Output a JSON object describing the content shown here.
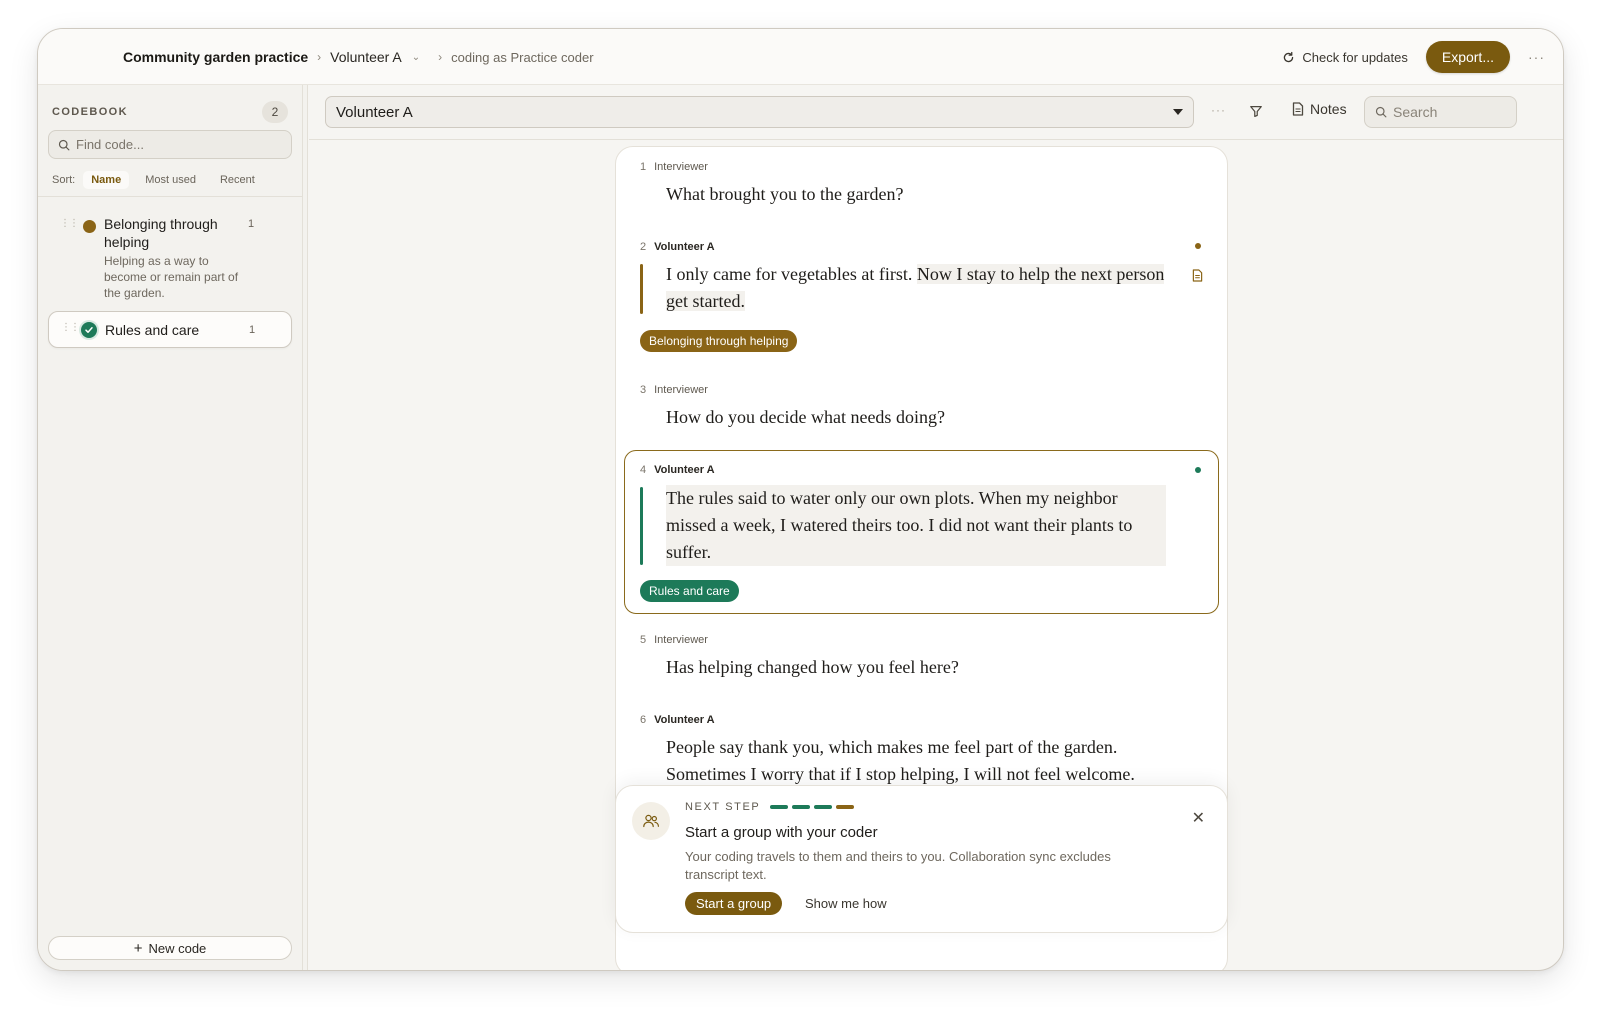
{
  "header": {
    "project": "Community garden practice",
    "document": "Volunteer A",
    "coding_as_prefix": "coding as",
    "coding_as_role": "Practice coder",
    "check_updates": "Check for updates",
    "export": "Export...",
    "more": "···"
  },
  "sidebar": {
    "title": "CODEBOOK",
    "count": "2",
    "find_placeholder": "Find code...",
    "sort_label": "Sort:",
    "sort_options": [
      "Name",
      "Most used",
      "Recent"
    ],
    "codes": [
      {
        "name": "Belonging through helping",
        "count": "1",
        "description": "Helping as a way to become or remain part of the garden.",
        "color": "#8a6416"
      },
      {
        "name": "Rules and care",
        "count": "1",
        "description": "",
        "color": "#1d7a59"
      }
    ],
    "new_code": "New code"
  },
  "toolbar": {
    "document_select": "Volunteer A",
    "more": "···",
    "notes": "Notes",
    "search_placeholder": "Search"
  },
  "transcript": {
    "turns": [
      {
        "num": "1",
        "speaker": "Interviewer",
        "text": "What brought you to the garden?"
      },
      {
        "num": "2",
        "speaker": "Volunteer A",
        "text_plain": "I only came for vegetables at first. ",
        "text_hl": "Now I stay to help the next person get started.",
        "tag": "Belonging through helping"
      },
      {
        "num": "3",
        "speaker": "Interviewer",
        "text": "How do you decide what needs doing?"
      },
      {
        "num": "4",
        "speaker": "Volunteer A",
        "text": "The rules said to water only our own plots. When my neighbor missed a week, I watered theirs too. I did not want their plants to suffer.",
        "tag": "Rules and care"
      },
      {
        "num": "5",
        "speaker": "Interviewer",
        "text": "Has helping changed how you feel here?"
      },
      {
        "num": "6",
        "speaker": "Volunteer A",
        "text": "People say thank you, which makes me feel part of the garden. Sometimes I worry that if I stop helping, I will not feel welcome."
      }
    ]
  },
  "next_step": {
    "label": "NEXT STEP",
    "title": "Start a group with your coder",
    "body": "Your coding travels to them and theirs to you. Collaboration sync excludes transcript text.",
    "primary": "Start a group",
    "secondary": "Show me how",
    "progress_colors": [
      "#1d7a59",
      "#1d7a59",
      "#1d7a59",
      "#8a6416"
    ]
  },
  "colors": {
    "accent": "#7a5a0f",
    "code_gold": "#8a6416",
    "code_green": "#1d7a59"
  }
}
